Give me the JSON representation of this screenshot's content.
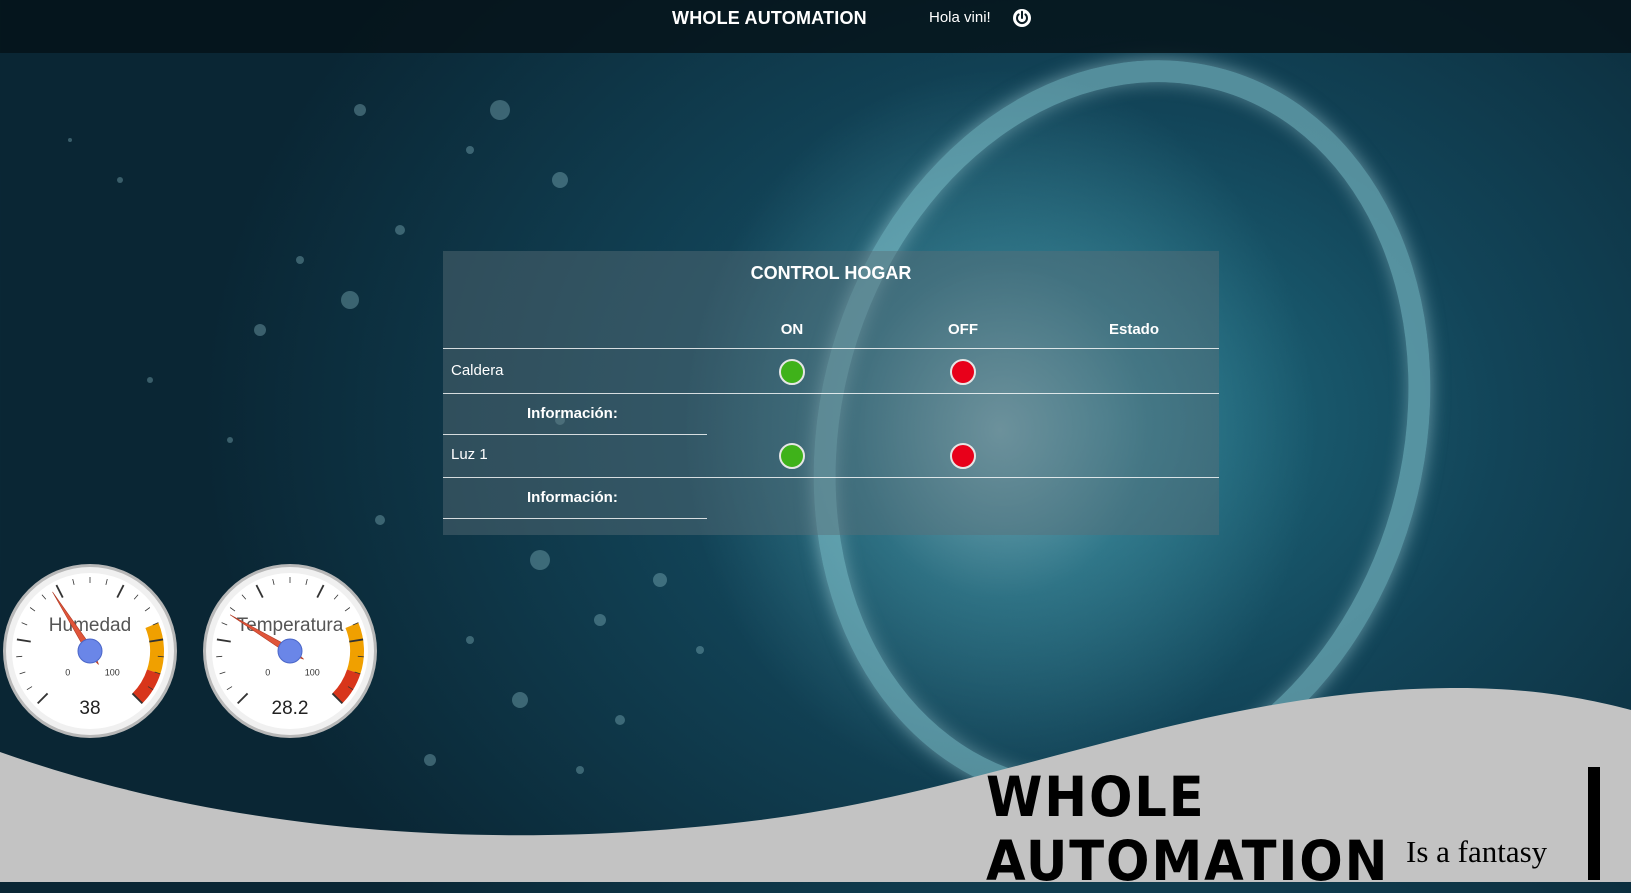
{
  "header": {
    "brand": "WHOLE AUTOMATION",
    "greeting": "Hola vini!",
    "logout_icon": "power-icon"
  },
  "control": {
    "title": "CONTROL HOGAR",
    "columns": {
      "on": "ON",
      "off": "OFF",
      "status": "Estado"
    },
    "devices": [
      {
        "name": "Caldera",
        "info_label": "Información:"
      },
      {
        "name": "Luz 1",
        "info_label": "Información:"
      }
    ],
    "colors": {
      "on": "#3fb21a",
      "off": "#e8001a"
    }
  },
  "gauges": [
    {
      "label": "Humedad",
      "value": 38,
      "display": "38",
      "min": 0,
      "max": 100,
      "min_label": "0",
      "max_label": "100"
    },
    {
      "label": "Temperatura",
      "value": 28.2,
      "display": "28.2",
      "min": 0,
      "max": 100,
      "min_label": "0",
      "max_label": "100"
    }
  ],
  "footer": {
    "logo_title": "WHOLE AUTOMATION",
    "logo_subtitle": "Is a fantasy"
  }
}
